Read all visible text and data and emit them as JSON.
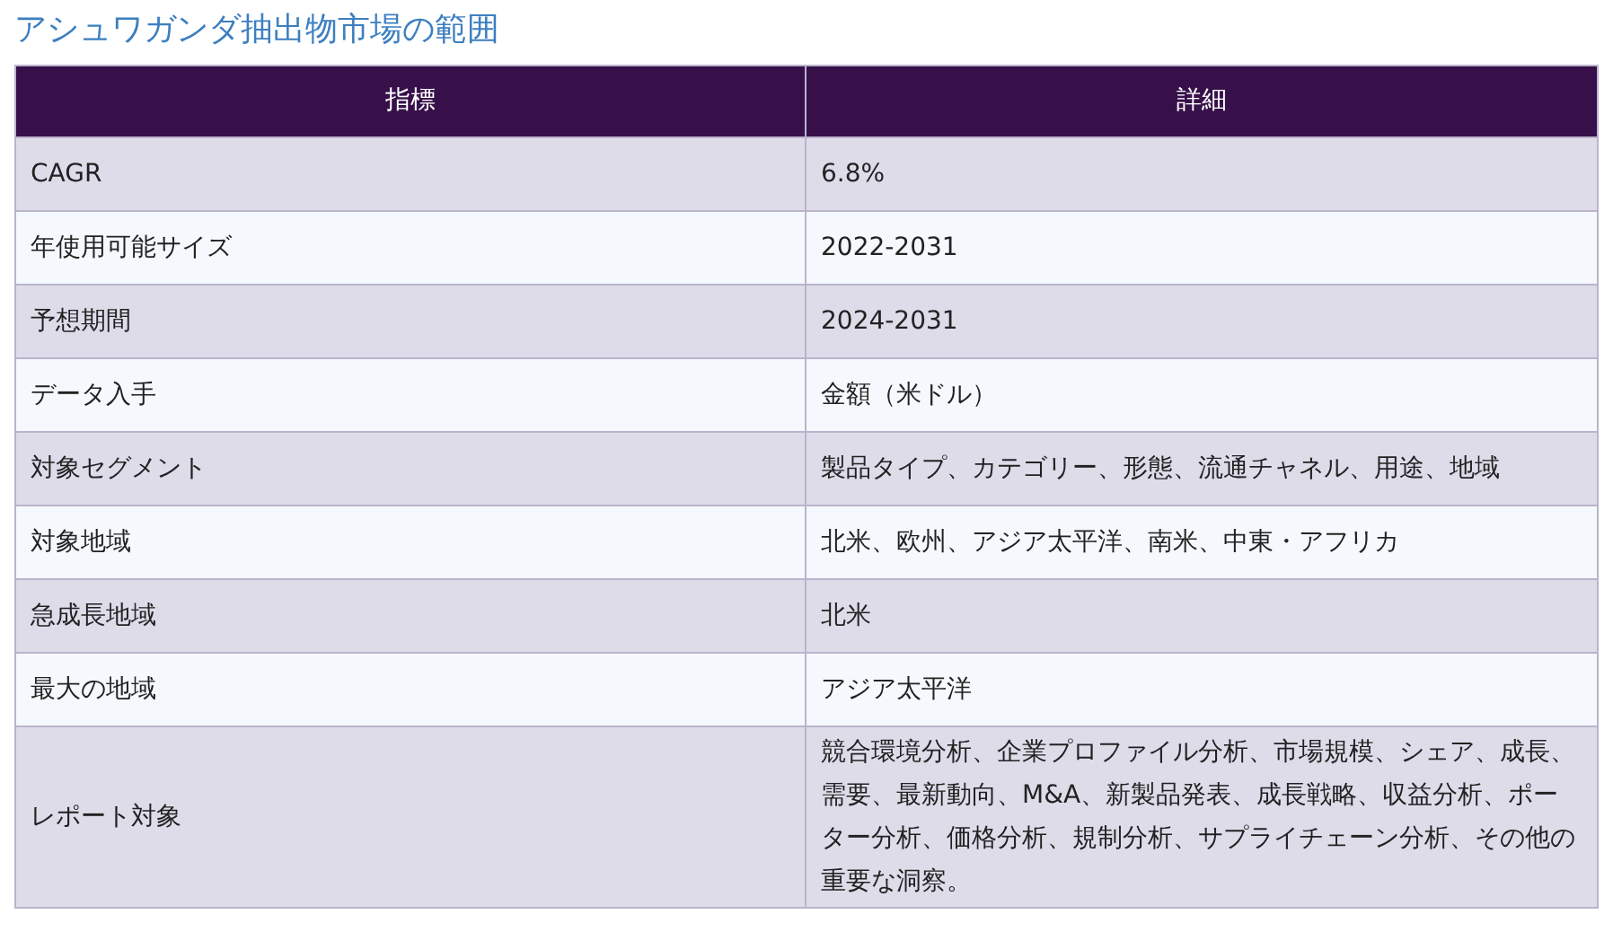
{
  "title": "アシュワガンダ抽出物市場の範囲",
  "table": {
    "columns": [
      "指標",
      "詳細"
    ],
    "rows": [
      [
        "CAGR",
        "6.8%"
      ],
      [
        "年使用可能サイズ",
        "2022-2031"
      ],
      [
        "予想期間",
        "2024-2031"
      ],
      [
        "データ入手",
        "金額（米ドル）"
      ],
      [
        "対象セグメント",
        "製品タイプ、カテゴリー、形態、流通チャネル、用途、地域"
      ],
      [
        "対象地域",
        "北米、欧州、アジア太平洋、南米、中東・アフリカ"
      ],
      [
        "急成長地域",
        "北米"
      ],
      [
        "最大の地域",
        "アジア太平洋"
      ],
      [
        "レポート対象",
        "競合環境分析、企業プロファイル分析、市場規模、シェア、成長、需要、最新動向、M&A、新製品発表、成長戦略、収益分析、ポーター分析、価格分析、規制分析、サプライチェーン分析、その他の重要な洞察。"
      ]
    ]
  }
}
